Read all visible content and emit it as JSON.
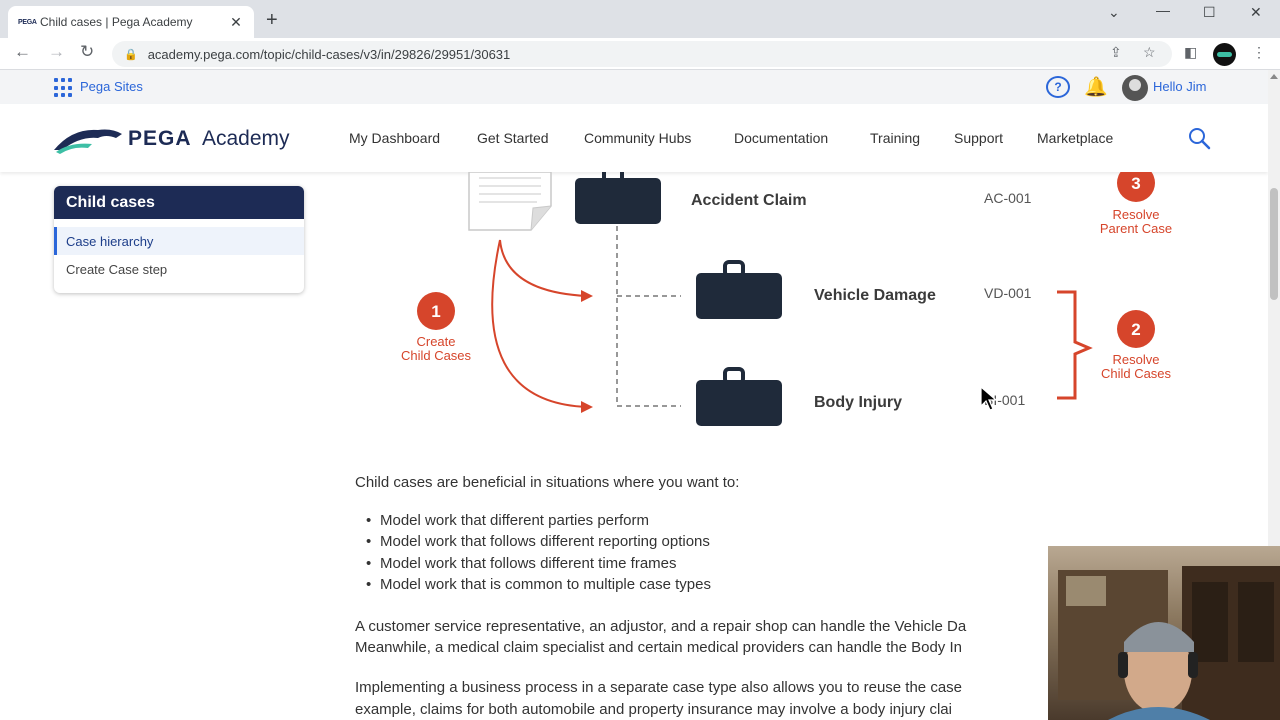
{
  "browser": {
    "tab_title": "Child cases | Pega Academy",
    "tab_favicon": "PEGA",
    "url": "academy.pega.com/topic/child-cases/v3/in/29826/29951/30631"
  },
  "sites_bar": {
    "sites_label": "Pega Sites",
    "help": "?",
    "greeting": "Hello Jim"
  },
  "header": {
    "logo_word1": "PEGA",
    "logo_word2": "Academy",
    "menu": [
      "My Dashboard",
      "Get Started",
      "Community Hubs",
      "Documentation",
      "Training",
      "Support",
      "Marketplace"
    ]
  },
  "sidebar": {
    "title": "Child cases",
    "items": [
      "Case hierarchy",
      "Create Case step"
    ]
  },
  "diagram": {
    "parent": {
      "name": "Accident Claim",
      "id": "AC-001"
    },
    "children": [
      {
        "name": "Vehicle Damage",
        "id": "VD-001"
      },
      {
        "name": "Body Injury",
        "id": "BI-001"
      }
    ],
    "steps": [
      {
        "number": "1",
        "line1": "Create",
        "line2": "Child Cases"
      },
      {
        "number": "2",
        "line1": "Resolve",
        "line2": "Child Cases"
      },
      {
        "number": "3",
        "line1": "Resolve",
        "line2": "Parent Case"
      }
    ],
    "accent_color": "#d6452b",
    "case_color": "#1f2a3a"
  },
  "content": {
    "intro": "Child cases are beneficial in situations where you want to:",
    "bullets": [
      "Model work that different parties perform",
      "Model work that follows different reporting options",
      "Model work that follows different time frames",
      "Model work that is common to multiple case types"
    ],
    "para1_line1": "A customer service representative, an adjustor, and a repair shop can handle the Vehicle Da",
    "para1_line2": "Meanwhile, a medical claim specialist and certain medical providers can handle the Body In",
    "para2_line1": "Implementing a business process in a separate case type also allows you to reuse the case",
    "para2_line2": "example, claims for both automobile and property insurance may involve a body injury clai"
  }
}
